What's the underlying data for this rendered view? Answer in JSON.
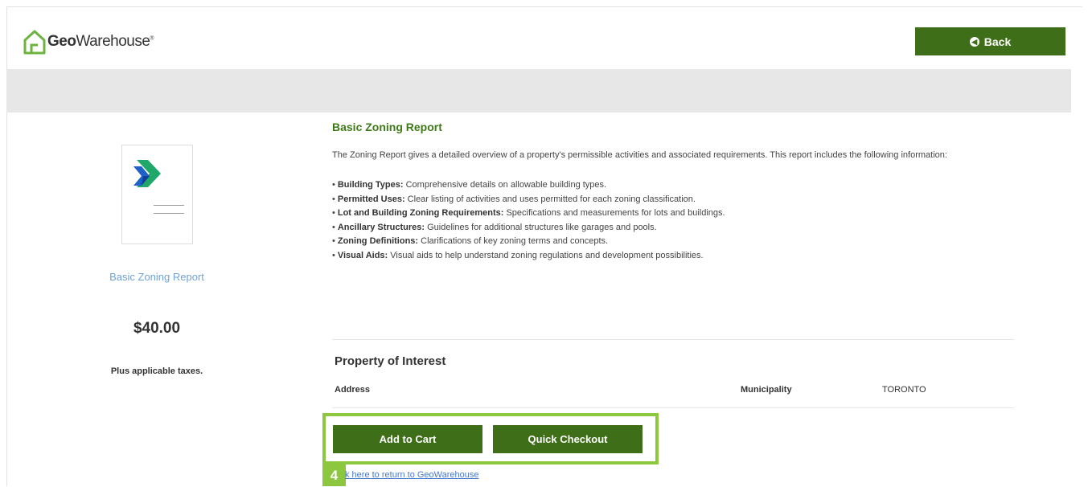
{
  "header": {
    "logo_bold": "Geo",
    "logo_rest": "Warehouse",
    "logo_mark": "®",
    "back_label": "Back",
    "back_icon": "circle-arrow-left-icon"
  },
  "sidebar": {
    "product_title": "Basic Zoning Report",
    "price": "$40.00",
    "tax_note": "Plus applicable taxes."
  },
  "report": {
    "title": "Basic Zoning Report",
    "intro": "The Zoning Report gives a detailed overview of a property's permissible activities and associated requirements. This report includes the following information:",
    "features": [
      {
        "label": "Building Types:",
        "text": " Comprehensive details on allowable building types."
      },
      {
        "label": "Permitted Uses:",
        "text": " Clear listing of activities and uses permitted for each zoning classification."
      },
      {
        "label": "Lot and Building Zoning Requirements:",
        "text": " Specifications and measurements for lots and buildings."
      },
      {
        "label": "Ancillary Structures:",
        "text": " Guidelines for additional structures like garages and pools."
      },
      {
        "label": "Zoning Definitions:",
        "text": " Clarifications of key zoning terms and concepts."
      },
      {
        "label": "Visual Aids:",
        "text": " Visual aids to help understand zoning regulations and development possibilities."
      }
    ]
  },
  "property": {
    "title": "Property of Interest",
    "address_label": "Address",
    "municipality_label": "Municipality",
    "municipality_value": "TORONTO"
  },
  "actions": {
    "add_to_cart": "Add to Cart",
    "quick_checkout": "Quick Checkout",
    "step_number": "4",
    "return_link": "k here to return to GeoWarehouse"
  },
  "colors": {
    "primary_green": "#3f6e18",
    "title_green": "#3f7a18",
    "highlight_green": "#8dc63f",
    "link_blue": "#4a78c8"
  }
}
